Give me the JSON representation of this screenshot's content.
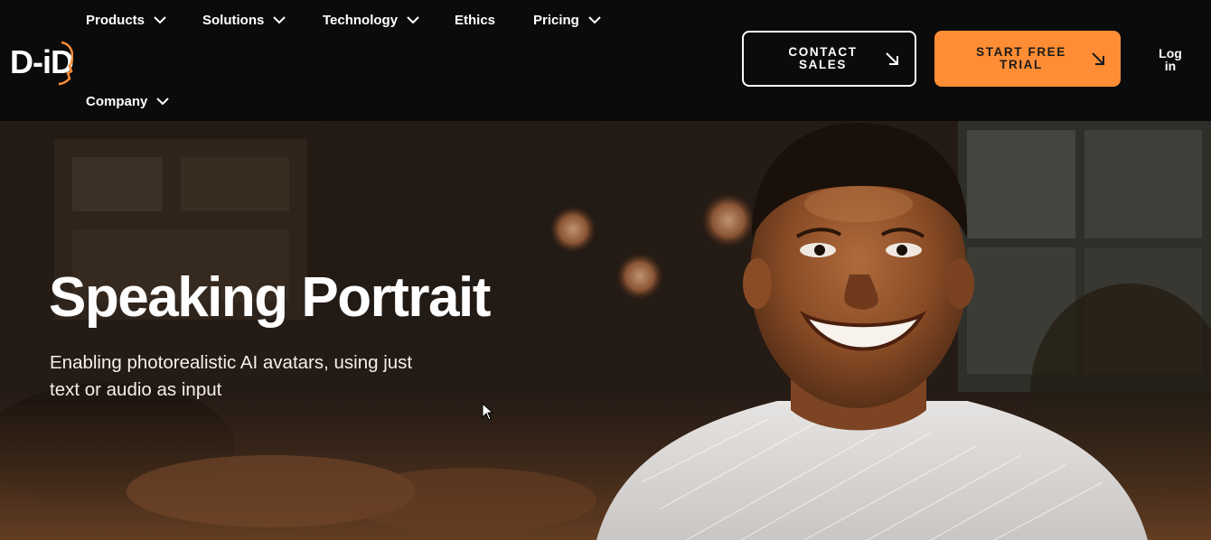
{
  "brand": {
    "logo_text": "D-iD",
    "accent": "#ff8d35"
  },
  "nav": {
    "menu": [
      {
        "label": "Products",
        "has_dropdown": true
      },
      {
        "label": "Solutions",
        "has_dropdown": true
      },
      {
        "label": "Technology",
        "has_dropdown": true
      },
      {
        "label": "Ethics",
        "has_dropdown": false
      },
      {
        "label": "Pricing",
        "has_dropdown": true
      },
      {
        "label": "Company",
        "has_dropdown": true
      }
    ],
    "contact_label": "CONTACT\nSALES",
    "trial_label": "START FREE\nTRIAL",
    "login_label": "Log\nin"
  },
  "hero": {
    "title": "Speaking Portrait",
    "subtitle": "Enabling photorealistic AI avatars, using just text or audio as input"
  },
  "icons": [
    "chevron-down-icon",
    "arrow-down-right-icon",
    "mouse-cursor-icon"
  ]
}
